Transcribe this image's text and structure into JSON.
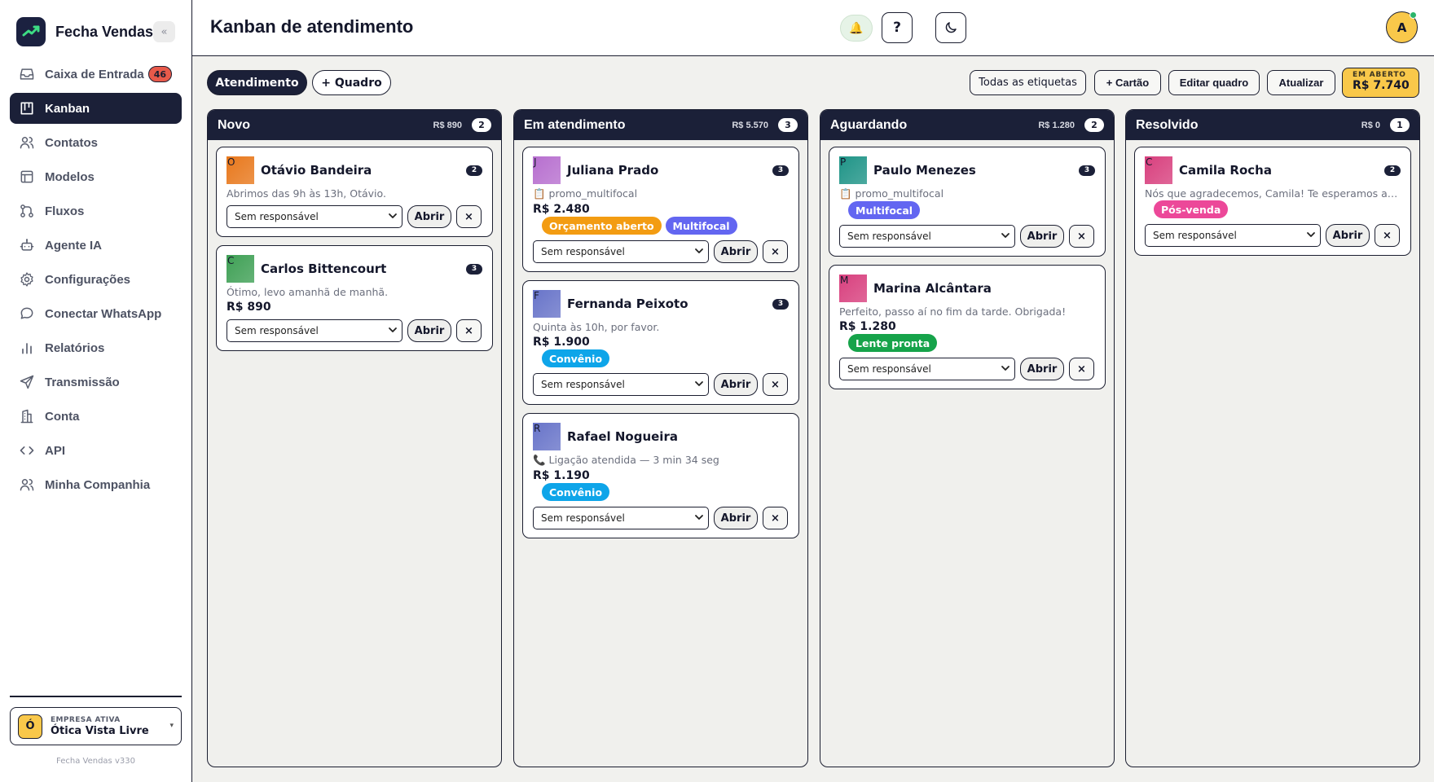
{
  "app": {
    "brand_name": "Fecha Vendas",
    "collapse_label": "«",
    "version": "Fecha Vendas v330"
  },
  "sidebar": {
    "items": [
      {
        "label": "Caixa de Entrada",
        "icon": "inbox-icon",
        "badge": "46",
        "active": false
      },
      {
        "label": "Kanban",
        "icon": "kanban-icon",
        "active": true
      },
      {
        "label": "Contatos",
        "icon": "contacts-icon",
        "active": false
      },
      {
        "label": "Modelos",
        "icon": "templates-icon",
        "active": false
      },
      {
        "label": "Fluxos",
        "icon": "flows-icon",
        "active": false
      },
      {
        "label": "Agente IA",
        "icon": "ai-agent-icon",
        "active": false
      },
      {
        "label": "Configurações",
        "icon": "gear-icon",
        "active": false
      },
      {
        "label": "Conectar WhatsApp",
        "icon": "chat-bubble-icon",
        "active": false
      },
      {
        "label": "Relatórios",
        "icon": "bar-chart-icon",
        "active": false
      },
      {
        "label": "Transmissão",
        "icon": "send-icon",
        "active": false
      },
      {
        "label": "Conta",
        "icon": "building-icon",
        "active": false
      },
      {
        "label": "API",
        "icon": "code-icon",
        "active": false
      },
      {
        "label": "Minha Companhia",
        "icon": "team-icon",
        "active": false
      }
    ],
    "company": {
      "caption": "EMPRESA ATIVA",
      "initial": "Ó",
      "name": "Ótica Vista Livre",
      "caret": "▾"
    }
  },
  "header": {
    "title": "Kanban de atendimento",
    "bell": "🔔",
    "help": "?",
    "avatar": "A"
  },
  "toolbar": {
    "tab_active": "Atendimento",
    "tab_new": "+ Quadro",
    "filter_labels": "Todas as etiquetas",
    "add_card": "+ Cartão",
    "edit_board": "Editar quadro",
    "refresh": "Atualizar",
    "open_caption": "EM ABERTO",
    "open_value": "R$ 7.740"
  },
  "colors": {
    "dark": "#1b2038",
    "accent_yellow": "#f9c84a",
    "tag_orange": "#f39c12",
    "tag_indigo": "#6366f1",
    "tag_blue": "#0ea5e9",
    "tag_green": "#16a34a",
    "tag_pink": "#ec4899"
  },
  "card_actions": {
    "assignee_placeholder": "Sem responsável",
    "open": "Abrir",
    "close": "×"
  },
  "columns": [
    {
      "title": "Novo",
      "total": "R$ 890",
      "count": "2",
      "cards": [
        {
          "initial": "O",
          "avatar_color": "#e8781c",
          "name": "Otávio Bandeira",
          "badge": "2",
          "preview": "Abrimos das 9h às 13h, Otávio.",
          "value": "",
          "tags": []
        },
        {
          "initial": "C",
          "avatar_color": "#3fa055",
          "name": "Carlos Bittencourt",
          "badge": "3",
          "preview": "Ótimo, levo amanhã de manhã.",
          "value": "R$ 890",
          "tags": []
        }
      ]
    },
    {
      "title": "Em atendimento",
      "total": "R$ 5.570",
      "count": "3",
      "cards": [
        {
          "initial": "J",
          "avatar_color": "#b76fcf",
          "name": "Juliana Prado",
          "badge": "3",
          "preview": "📋 promo_multifocal",
          "value": "R$ 2.480",
          "tags": [
            {
              "label": "Orçamento aberto",
              "color": "#f39c12"
            },
            {
              "label": "Multifocal",
              "color": "#6366f1"
            }
          ]
        },
        {
          "initial": "F",
          "avatar_color": "#6874c9",
          "name": "Fernanda Peixoto",
          "badge": "3",
          "preview": "Quinta às 10h, por favor.",
          "value": "R$ 1.900",
          "tags": [
            {
              "label": "Convênio",
              "color": "#0ea5e9"
            }
          ]
        },
        {
          "initial": "R",
          "avatar_color": "#6874c9",
          "name": "Rafael Nogueira",
          "badge": "",
          "preview": "📞 Ligação atendida — 3 min 34 seg",
          "value": "R$ 1.190",
          "tags": [
            {
              "label": "Convênio",
              "color": "#0ea5e9"
            }
          ]
        }
      ]
    },
    {
      "title": "Aguardando",
      "total": "R$ 1.280",
      "count": "2",
      "cards": [
        {
          "initial": "P",
          "avatar_color": "#1f9487",
          "name": "Paulo Menezes",
          "badge": "3",
          "preview": "📋 promo_multifocal",
          "value": "",
          "tags": [
            {
              "label": "Multifocal",
              "color": "#6366f1"
            }
          ]
        },
        {
          "initial": "M",
          "avatar_color": "#d8407e",
          "name": "Marina Alcântara",
          "badge": "",
          "preview": "Perfeito, passo aí no fim da tarde. Obrigada!",
          "value": "R$ 1.280",
          "tags": [
            {
              "label": "Lente pronta",
              "color": "#16a34a"
            }
          ]
        }
      ]
    },
    {
      "title": "Resolvido",
      "total": "R$ 0",
      "count": "1",
      "cards": [
        {
          "initial": "C",
          "avatar_color": "#d8407e",
          "name": "Camila Rocha",
          "badge": "2",
          "preview": "Nós que agradecemos, Camila! Te esperamos aq...",
          "value": "",
          "tags": [
            {
              "label": "Pós-venda",
              "color": "#ec4899"
            }
          ]
        }
      ]
    }
  ]
}
